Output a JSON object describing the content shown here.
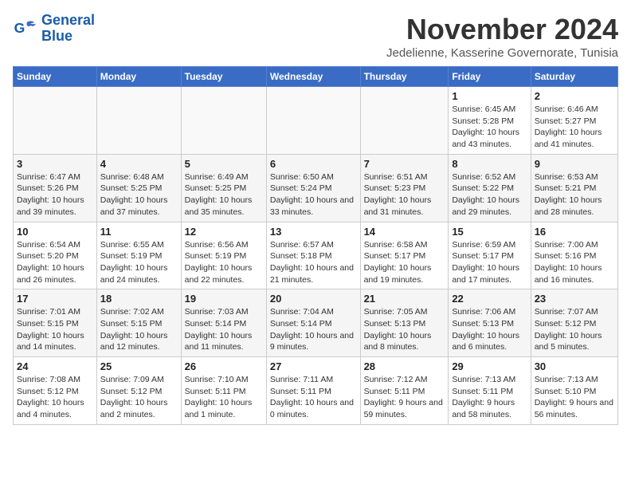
{
  "logo": {
    "line1": "General",
    "line2": "Blue"
  },
  "title": "November 2024",
  "subtitle": "Jedelienne, Kasserine Governorate, Tunisia",
  "days_of_week": [
    "Sunday",
    "Monday",
    "Tuesday",
    "Wednesday",
    "Thursday",
    "Friday",
    "Saturday"
  ],
  "weeks": [
    [
      {
        "date": "",
        "info": ""
      },
      {
        "date": "",
        "info": ""
      },
      {
        "date": "",
        "info": ""
      },
      {
        "date": "",
        "info": ""
      },
      {
        "date": "",
        "info": ""
      },
      {
        "date": "1",
        "info": "Sunrise: 6:45 AM\nSunset: 5:28 PM\nDaylight: 10 hours and 43 minutes."
      },
      {
        "date": "2",
        "info": "Sunrise: 6:46 AM\nSunset: 5:27 PM\nDaylight: 10 hours and 41 minutes."
      }
    ],
    [
      {
        "date": "3",
        "info": "Sunrise: 6:47 AM\nSunset: 5:26 PM\nDaylight: 10 hours and 39 minutes."
      },
      {
        "date": "4",
        "info": "Sunrise: 6:48 AM\nSunset: 5:25 PM\nDaylight: 10 hours and 37 minutes."
      },
      {
        "date": "5",
        "info": "Sunrise: 6:49 AM\nSunset: 5:25 PM\nDaylight: 10 hours and 35 minutes."
      },
      {
        "date": "6",
        "info": "Sunrise: 6:50 AM\nSunset: 5:24 PM\nDaylight: 10 hours and 33 minutes."
      },
      {
        "date": "7",
        "info": "Sunrise: 6:51 AM\nSunset: 5:23 PM\nDaylight: 10 hours and 31 minutes."
      },
      {
        "date": "8",
        "info": "Sunrise: 6:52 AM\nSunset: 5:22 PM\nDaylight: 10 hours and 29 minutes."
      },
      {
        "date": "9",
        "info": "Sunrise: 6:53 AM\nSunset: 5:21 PM\nDaylight: 10 hours and 28 minutes."
      }
    ],
    [
      {
        "date": "10",
        "info": "Sunrise: 6:54 AM\nSunset: 5:20 PM\nDaylight: 10 hours and 26 minutes."
      },
      {
        "date": "11",
        "info": "Sunrise: 6:55 AM\nSunset: 5:19 PM\nDaylight: 10 hours and 24 minutes."
      },
      {
        "date": "12",
        "info": "Sunrise: 6:56 AM\nSunset: 5:19 PM\nDaylight: 10 hours and 22 minutes."
      },
      {
        "date": "13",
        "info": "Sunrise: 6:57 AM\nSunset: 5:18 PM\nDaylight: 10 hours and 21 minutes."
      },
      {
        "date": "14",
        "info": "Sunrise: 6:58 AM\nSunset: 5:17 PM\nDaylight: 10 hours and 19 minutes."
      },
      {
        "date": "15",
        "info": "Sunrise: 6:59 AM\nSunset: 5:17 PM\nDaylight: 10 hours and 17 minutes."
      },
      {
        "date": "16",
        "info": "Sunrise: 7:00 AM\nSunset: 5:16 PM\nDaylight: 10 hours and 16 minutes."
      }
    ],
    [
      {
        "date": "17",
        "info": "Sunrise: 7:01 AM\nSunset: 5:15 PM\nDaylight: 10 hours and 14 minutes."
      },
      {
        "date": "18",
        "info": "Sunrise: 7:02 AM\nSunset: 5:15 PM\nDaylight: 10 hours and 12 minutes."
      },
      {
        "date": "19",
        "info": "Sunrise: 7:03 AM\nSunset: 5:14 PM\nDaylight: 10 hours and 11 minutes."
      },
      {
        "date": "20",
        "info": "Sunrise: 7:04 AM\nSunset: 5:14 PM\nDaylight: 10 hours and 9 minutes."
      },
      {
        "date": "21",
        "info": "Sunrise: 7:05 AM\nSunset: 5:13 PM\nDaylight: 10 hours and 8 minutes."
      },
      {
        "date": "22",
        "info": "Sunrise: 7:06 AM\nSunset: 5:13 PM\nDaylight: 10 hours and 6 minutes."
      },
      {
        "date": "23",
        "info": "Sunrise: 7:07 AM\nSunset: 5:12 PM\nDaylight: 10 hours and 5 minutes."
      }
    ],
    [
      {
        "date": "24",
        "info": "Sunrise: 7:08 AM\nSunset: 5:12 PM\nDaylight: 10 hours and 4 minutes."
      },
      {
        "date": "25",
        "info": "Sunrise: 7:09 AM\nSunset: 5:12 PM\nDaylight: 10 hours and 2 minutes."
      },
      {
        "date": "26",
        "info": "Sunrise: 7:10 AM\nSunset: 5:11 PM\nDaylight: 10 hours and 1 minute."
      },
      {
        "date": "27",
        "info": "Sunrise: 7:11 AM\nSunset: 5:11 PM\nDaylight: 10 hours and 0 minutes."
      },
      {
        "date": "28",
        "info": "Sunrise: 7:12 AM\nSunset: 5:11 PM\nDaylight: 9 hours and 59 minutes."
      },
      {
        "date": "29",
        "info": "Sunrise: 7:13 AM\nSunset: 5:11 PM\nDaylight: 9 hours and 58 minutes."
      },
      {
        "date": "30",
        "info": "Sunrise: 7:13 AM\nSunset: 5:10 PM\nDaylight: 9 hours and 56 minutes."
      }
    ]
  ]
}
